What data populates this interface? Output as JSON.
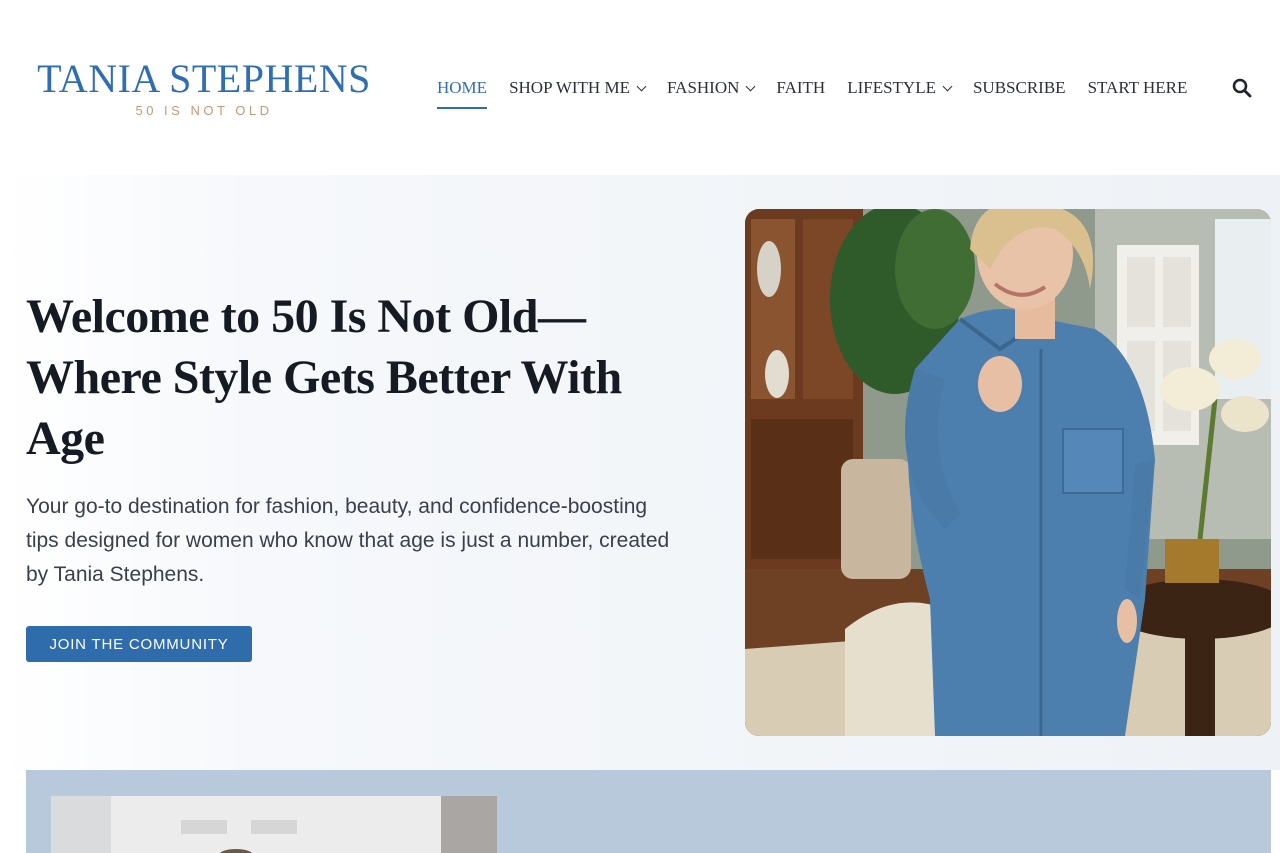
{
  "brand": {
    "name": "TANIA STEPHENS",
    "tagline": "50 IS NOT OLD",
    "primary_color": "#2f6fb1",
    "accent_color": "#c19a77"
  },
  "nav": {
    "items": [
      {
        "label": "HOME",
        "active": true,
        "dropdown": false
      },
      {
        "label": "SHOP WITH ME",
        "active": false,
        "dropdown": true
      },
      {
        "label": "FASHION",
        "active": false,
        "dropdown": true
      },
      {
        "label": "FAITH",
        "active": false,
        "dropdown": false
      },
      {
        "label": "LIFESTYLE",
        "active": false,
        "dropdown": true
      },
      {
        "label": "SUBSCRIBE",
        "active": false,
        "dropdown": false
      },
      {
        "label": "START HERE",
        "active": false,
        "dropdown": false
      }
    ],
    "search_icon": "search-icon"
  },
  "hero": {
    "title": "Welcome to 50 Is Not Old—Where Style Gets Better With Age",
    "text": "Your go-to destination for fashion, beauty, and confidence-boosting tips designed for women who know that age is just a number, created by Tania Stephens.",
    "cta_label": "JOIN THE COMMUNITY",
    "cta_color": "#2f6cac"
  },
  "lower_section": {
    "background": "#b9c9dc"
  }
}
